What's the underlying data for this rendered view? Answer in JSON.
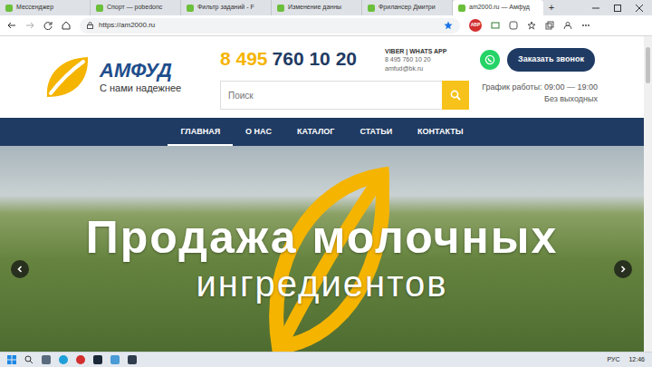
{
  "browser": {
    "tabs": [
      {
        "label": "Мессенджер",
        "selected": false
      },
      {
        "label": "Спорт — pobedonc",
        "selected": false
      },
      {
        "label": "Фильтр заданий - F",
        "selected": false
      },
      {
        "label": "Изменение данны",
        "selected": false
      },
      {
        "label": "Фрилансер Дмитри",
        "selected": false
      },
      {
        "label": "am2000.ru — Амфуд",
        "selected": true
      }
    ],
    "new_tab": "+",
    "address": "https://am2000.ru",
    "extensions": [
      {
        "label": "ABP"
      }
    ]
  },
  "site": {
    "logo": {
      "name": "АМФУД",
      "tagline": "С нами надежнее"
    },
    "phone": {
      "code": "8 495",
      "number": "760 10 20"
    },
    "messengers": {
      "title": "VIBER | WHATS APP",
      "phone": "8 495 760 10 20",
      "email": "amfud@bk.ru"
    },
    "search": {
      "placeholder": "Поиск"
    },
    "callback_button": "Заказать звонок",
    "schedule": [
      "График работы: 09:00 — 19:00",
      "Без выходных"
    ],
    "nav": [
      {
        "label": "ГЛАВНАЯ",
        "selected": true
      },
      {
        "label": "О НАС",
        "selected": false
      },
      {
        "label": "КАТАЛОГ",
        "selected": false
      },
      {
        "label": "СТАТЬИ",
        "selected": false
      },
      {
        "label": "КОНТАКТЫ",
        "selected": false
      }
    ],
    "hero": {
      "title": "Продажа молочных",
      "subtitle": "ингредиентов"
    }
  },
  "taskbar": {
    "language": "РУС",
    "time": "12:46"
  }
}
